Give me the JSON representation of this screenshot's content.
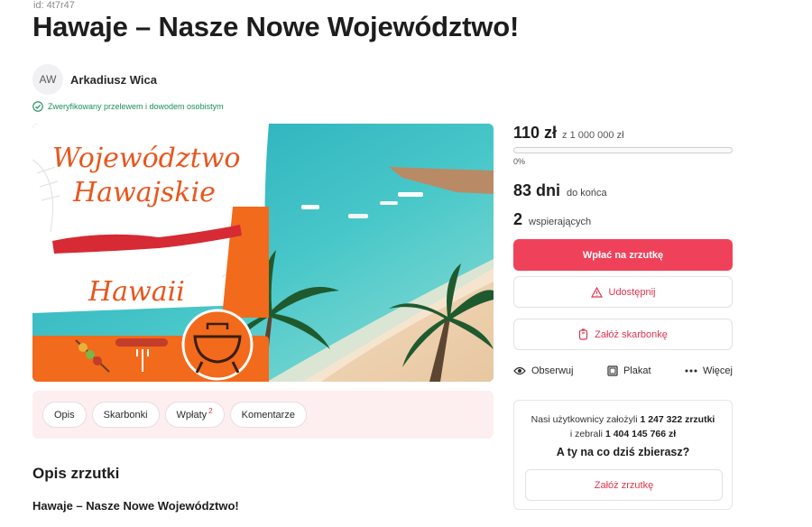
{
  "page": {
    "id_label": "id: 4t7r47",
    "title": "Hawaje – Nasze Nowe Województwo!"
  },
  "author": {
    "initials": "AW",
    "name": "Arkadiusz Wica",
    "verified_text": "Zweryfikowany przelewem i dowodem osobistym"
  },
  "hero": {
    "heading_line1": "Województwo",
    "heading_line2": "Hawajskie",
    "subheading": "Hawaii"
  },
  "tabs": [
    {
      "label": "Opis",
      "badge": ""
    },
    {
      "label": "Skarbonki",
      "badge": ""
    },
    {
      "label": "Wpłaty",
      "badge": "2"
    },
    {
      "label": "Komentarze",
      "badge": ""
    }
  ],
  "content": {
    "section_title": "Opis zrzutki",
    "description_title": "Hawaje – Nasze Nowe Województwo!"
  },
  "stats": {
    "raised": "110 zł",
    "goal": "z 1 000 000 zł",
    "progress_percent_label": "0%",
    "progress_fraction": 0.0001,
    "days_value": "83 dni",
    "days_label": "do końca",
    "supporters_value": "2",
    "supporters_label": "wspierających"
  },
  "buttons": {
    "pay": "Wpłać na zrzutkę",
    "share": "Udostępnij",
    "piggy": "Załóż skarbonkę"
  },
  "actions": {
    "watch": "Obserwuj",
    "poster": "Plakat",
    "more": "Więcej"
  },
  "promo": {
    "line1_prefix": "Nasi użytkownicy założyli ",
    "line1_count": "1 247 322 zrzutki",
    "line2_prefix": "i zebrali ",
    "line2_amount": "1 404 145 766 zł",
    "question": "A ty na co dziś zbierasz?",
    "create_button": "Załóż zrzutkę"
  },
  "colors": {
    "accent": "#f0415a",
    "verified": "#1c8f5a",
    "tabs_bg": "#fdeef0",
    "hero_orange": "#f26a1b"
  }
}
